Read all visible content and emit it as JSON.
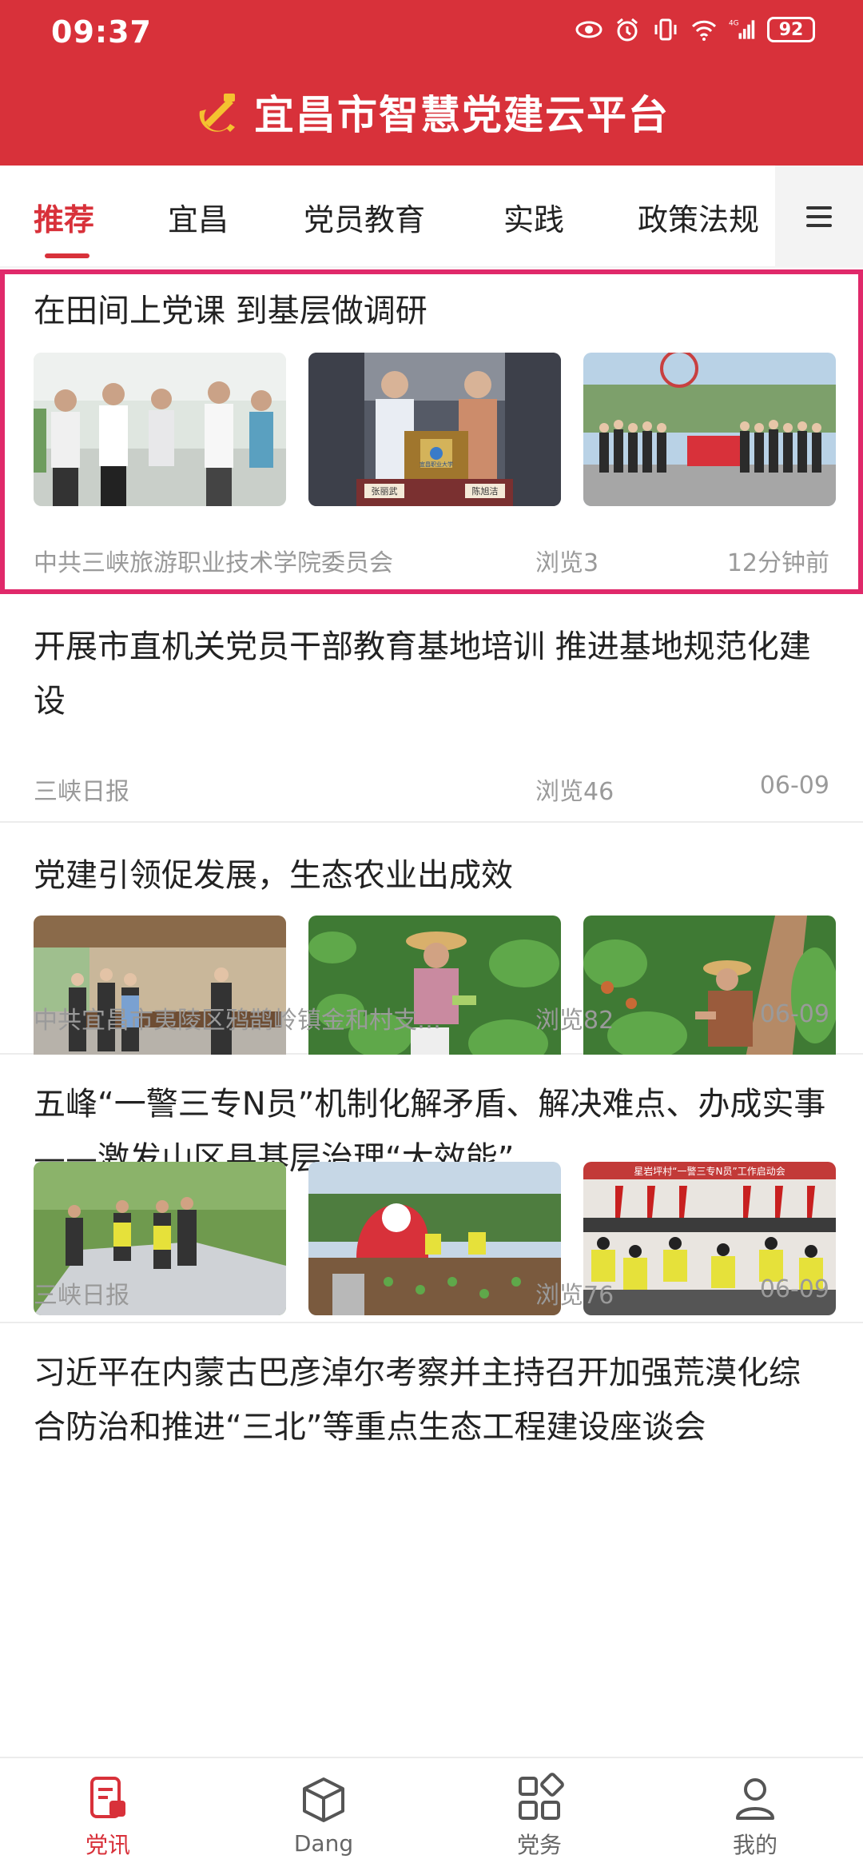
{
  "status_bar": {
    "time": "09:37",
    "battery": "92",
    "signal_label": "4G"
  },
  "app": {
    "title": "宜昌市智慧党建云平台"
  },
  "tabs": [
    {
      "label": "推荐",
      "active": true
    },
    {
      "label": "宜昌",
      "active": false
    },
    {
      "label": "党员教育",
      "active": false
    },
    {
      "label": "实践",
      "active": false
    },
    {
      "label": "政策法规",
      "active": false
    }
  ],
  "articles": [
    {
      "title": "在田间上党课 到基层做调研",
      "source": "中共三峡旅游职业技术学院委员会",
      "views": "浏览3",
      "time": "12分钟前",
      "image_count": 3,
      "photo_captions": [
        "张丽武",
        "陈旭洁",
        "宜昌职业大学"
      ]
    },
    {
      "title": "开展市直机关党员干部教育基地培训 推进基地规范化建设",
      "source": "三峡日报",
      "views": "浏览46",
      "time": "06-09",
      "image_count": 0
    },
    {
      "title": "党建引领促发展，生态农业出成效",
      "source": "中共宜昌市夷陵区鸦鹊岭镇金和村支…",
      "views": "浏览82",
      "time": "06-09",
      "image_count": 3
    },
    {
      "title": "五峰“一警三专N员”机制化解矛盾、解决难点、办成实事——激发山区县基层治理“大效能”",
      "source": "三峡日报",
      "views": "浏览76",
      "time": "06-09",
      "image_count": 3,
      "photo_captions": [
        "星岩坪村“一警三专N员”工作启动会"
      ]
    },
    {
      "title": "习近平在内蒙古巴彦淖尔考察并主持召开加强荒漠化综合防治和推进“三北”等重点生态工程建设座谈会",
      "source": "",
      "views": "",
      "time": "",
      "image_count": 0
    }
  ],
  "bottom_nav": [
    {
      "label": "党讯",
      "icon": "news-icon",
      "active": true
    },
    {
      "label": "Dang",
      "icon": "cube-icon",
      "active": false
    },
    {
      "label": "党务",
      "icon": "apps-icon",
      "active": false
    },
    {
      "label": "我的",
      "icon": "person-icon",
      "active": false
    }
  ],
  "colors": {
    "brand_red": "#d8313a",
    "highlight_pink": "#e0296a",
    "meta_gray": "#9a9a9a"
  }
}
